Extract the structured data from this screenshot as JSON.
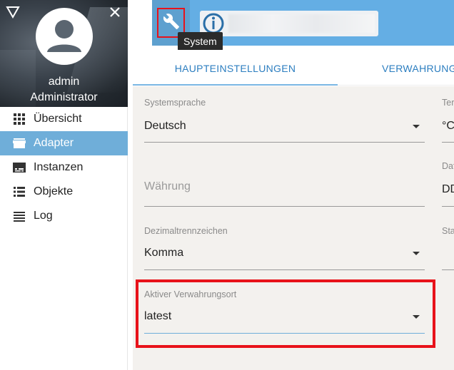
{
  "sidebar": {
    "user_name": "admin",
    "user_role": "Administrator",
    "items": [
      {
        "label": "Übersicht",
        "icon": "grid-icon",
        "active": false
      },
      {
        "label": "Adapter",
        "icon": "store-icon",
        "active": true
      },
      {
        "label": "Instanzen",
        "icon": "subtitles-icon",
        "active": false
      },
      {
        "label": "Objekte",
        "icon": "list-icon",
        "active": false
      },
      {
        "label": "Log",
        "icon": "lines-icon",
        "active": false
      }
    ]
  },
  "header": {
    "tool_icon": "wrench-icon",
    "tooltip": "System",
    "logo_icon": "iobroker-logo-icon"
  },
  "tabs": [
    {
      "label": "HAUPTEINSTELLUNGEN",
      "active": true
    },
    {
      "label": "VERWAHRUNG",
      "active": false
    }
  ],
  "form": {
    "language": {
      "label": "Systemsprache",
      "value": "Deutsch"
    },
    "currency": {
      "placeholder": "Währung"
    },
    "decimal": {
      "label": "Dezimaltrennzeichen",
      "value": "Komma"
    },
    "repo": {
      "label": "Aktiver Verwahrungsort",
      "value": "latest"
    },
    "right_col": {
      "temp_label": "Ter",
      "temp_value": "°C",
      "date_label": "Dat",
      "date_value": "DD",
      "state_label": "Sta"
    }
  },
  "colors": {
    "accent_blue": "#64aee4",
    "active_nav": "#6faed9",
    "highlight_red": "#e8121a"
  }
}
